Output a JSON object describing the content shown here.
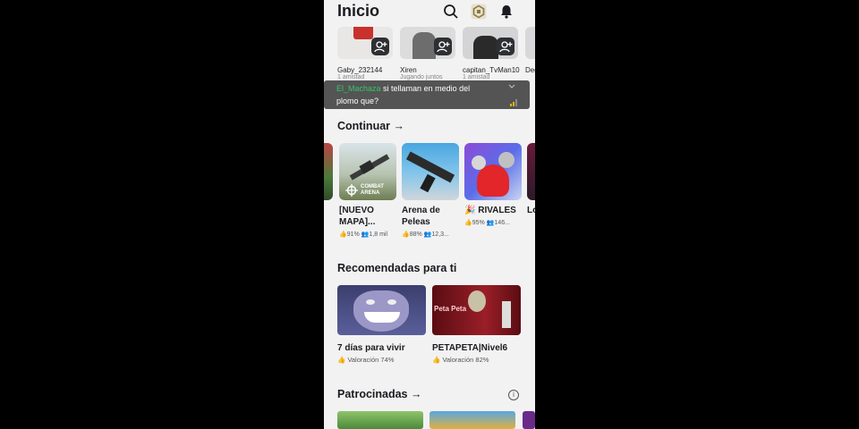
{
  "header": {
    "title": "Inicio"
  },
  "friends": [
    {
      "name": "Gaby_232144",
      "status": "1 amistad"
    },
    {
      "name": "Xiren",
      "status": "Jugando juntos"
    },
    {
      "name": "capitan_TvMan10",
      "status": "1 amistad"
    },
    {
      "name": "Deg",
      "status": ""
    }
  ],
  "toast": {
    "user": "El_Machaza",
    "message": "si tellaman en medio del plomo que?"
  },
  "continuar": {
    "title": "Continuar",
    "games": [
      {
        "name": "[NUEVO MAPA]...",
        "rating": "91%",
        "players": "1,8 mil",
        "logo": "COMBAT ARENA"
      },
      {
        "name": "Arena de Peleas",
        "rating": "88%",
        "players": "12,3..."
      },
      {
        "name": "🎉 RIVALES",
        "rating": "95%",
        "players": "146..."
      },
      {
        "name": "Lo de",
        "rating": "",
        "players": ""
      }
    ]
  },
  "recomendadas": {
    "title": "Recomendadas para ti",
    "games": [
      {
        "name": "7 días para vivir",
        "rating": "Valoración 74%"
      },
      {
        "name": "PETAPETA|Nivel6",
        "rating": "Valoración 82%",
        "thumb_text": "Peta Peta"
      }
    ]
  },
  "patrocinadas": {
    "title": "Patrocinadas"
  },
  "colors": {
    "background": "#f2f2f3",
    "text": "#1b1b1f",
    "accent_green": "#35c46a"
  }
}
